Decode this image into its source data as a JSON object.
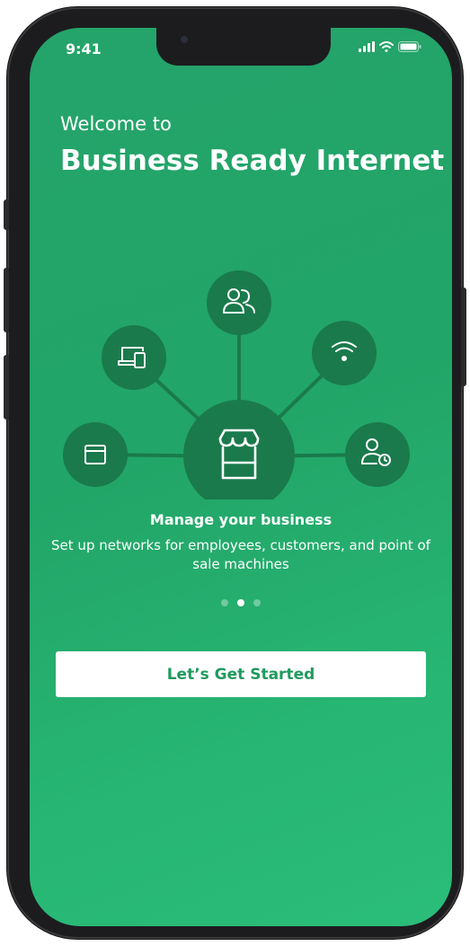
{
  "status_bar": {
    "time": "9:41"
  },
  "header": {
    "welcome": "Welcome to",
    "product": "Business Ready Internet"
  },
  "illustration": {
    "center_icon": "storefront-icon",
    "nodes": [
      "users-icon",
      "devices-icon",
      "wifi-icon",
      "browser-window-icon",
      "user-clock-icon"
    ]
  },
  "feature": {
    "title": "Manage your business",
    "description": "Set up networks for employees, customers, and point of sale machines"
  },
  "pagination": {
    "count": 3,
    "active": 2
  },
  "cta": {
    "label": "Let’s Get Started"
  },
  "colors": {
    "screen_bg": "#24a46a",
    "circle": "#1a7a4c",
    "button_text": "#1f9a5f"
  }
}
